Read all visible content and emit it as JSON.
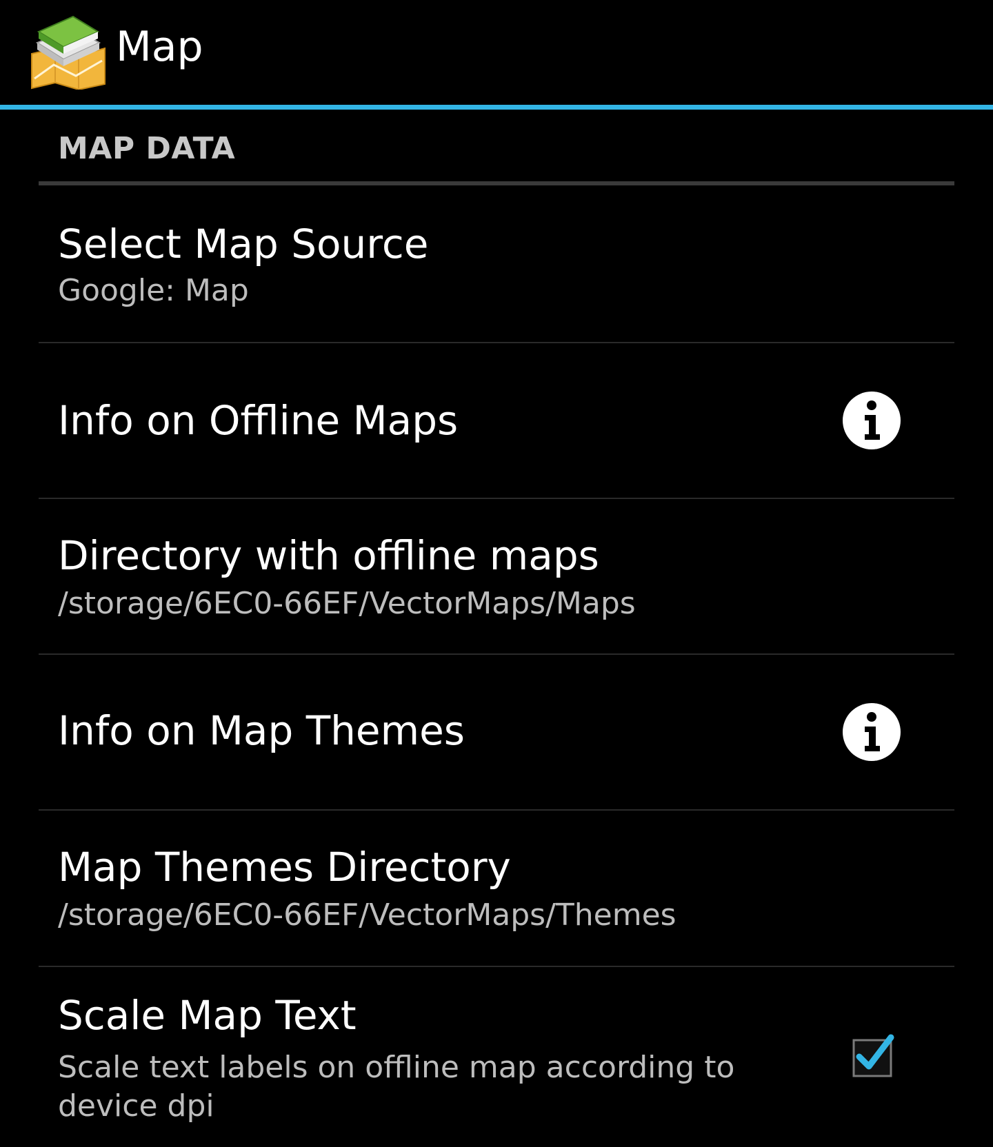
{
  "action_bar": {
    "title": "Map",
    "icon": "map-app-icon"
  },
  "colors": {
    "accent": "#33b5e5",
    "background": "#000000",
    "summary_text": "#bdbdbd"
  },
  "section": {
    "header": "MAP DATA"
  },
  "preferences": [
    {
      "title": "Select Map Source",
      "summary": "Google: Map"
    },
    {
      "title": "Info on Offline Maps",
      "icon": "info-icon"
    },
    {
      "title": "Directory with offline maps",
      "summary": "/storage/6EC0-66EF/VectorMaps/Maps"
    },
    {
      "title": "Info on Map Themes",
      "icon": "info-icon"
    },
    {
      "title": "Map Themes Directory",
      "summary": "/storage/6EC0-66EF/VectorMaps/Themes"
    },
    {
      "title": "Scale Map Text",
      "summary": "Scale text labels on offline map according to device dpi",
      "checked": true
    }
  ]
}
